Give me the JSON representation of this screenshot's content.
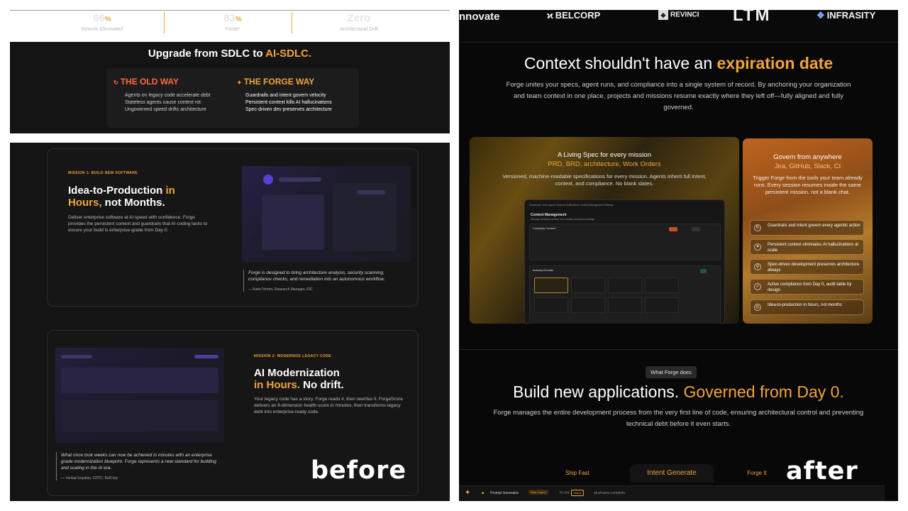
{
  "before": {
    "stats": [
      {
        "value": "66",
        "unit": "%",
        "label": "Rework Eliminated"
      },
      {
        "value": "83",
        "unit": "%",
        "label": "Faster"
      },
      {
        "value": "Zero",
        "unit": "",
        "label": "Architectural Drift"
      }
    ],
    "upgrade": {
      "title_pre": "Upgrade from SDLC to ",
      "title_hl": "AI-SDLC.",
      "old": {
        "title": "THE OLD WAY",
        "items": [
          "Agents on legacy code accelerate debt",
          "Stateless agents cause context rot",
          "Ungoverned speed drifts architecture"
        ]
      },
      "forge": {
        "title": "THE FORGE WAY",
        "items": [
          "Guardrails and intent govern velocity",
          "Persistent context kills AI hallucinations",
          "Spec-driven dev preserves architecture"
        ]
      }
    },
    "mission1": {
      "tag": "MISSION 1: BUILD NEW SOFTWARE",
      "title_a": "Idea-to-Production ",
      "title_hl": "in Hours,",
      "title_b": " not Months.",
      "desc": "Deliver enterprise software at AI speed with confidence. Forge provides the persistent context and guardrails that AI coding lacks to ensure your build is enterprise-grade from Day 0.",
      "quote": "Forge is designed to bring architecture analysis, security scanning, compliance checks, and remediation into an autonomous workflow.",
      "author": "— Katie Norton, Research Manager, IDC"
    },
    "mission2": {
      "tag": "MISSION 2: MODERNIZE LEGACY CODE",
      "title_a": "AI Modernization",
      "title_hl": "in Hours.",
      "title_b": " No drift.",
      "desc": "Your legacy code has a story. Forge reads it, then rewrites it. ForgeScore delivers an 8-dimension health score in minutes, then transforms legacy debt into enterprise-ready code.",
      "quote": "What once took weeks can now be achieved in minutes with an enterprise grade modernization blueprint. Forge represents a new standard for building and scaling in the AI era.",
      "author": "— Venkat Gopalan, CDTO, BelCorp"
    },
    "label": "before"
  },
  "after": {
    "logos": [
      "nnovate",
      "BELCORP",
      "REVINCI",
      "LTM",
      "INFRASITY"
    ],
    "context": {
      "title_pre": "Context shouldn't have an ",
      "title_hl": "expiration date",
      "subtitle": "Forge unites your specs, agent runs, and compliance into a single system of record. By anchoring your organization and team context in one place, projects and missions resume exactly where they left off—fully aligned and fully governed."
    },
    "living_spec": {
      "title": "A Living Spec for every mission",
      "title_hl": "PRD, BRD, architecture, Work Orders",
      "desc": "Versioned, machine-readable specifications for every mission. Agents inherit full intent, context, and compliance. No blank slates.",
      "mock": {
        "nav": "Dashboard   Jobs   Agents   Reports   Notifications   Context Management   Settings",
        "heading": "Context Management",
        "sub": "Manage company context and industry domain knowledge",
        "section1": "Company Context",
        "section2": "Industry Domain"
      }
    },
    "govern": {
      "title": "Govern from anywhere",
      "title_hl": "Jira, GitHub, Slack, CI",
      "desc": "Trigger Forge from the tools your team already runs. Every session resumes inside the same persistent mission, not a blank chat.",
      "features": [
        "Guardrails and intent govern every agentic action",
        "Persistent context eliminates AI hallucinations at scale",
        "Spec-driven development preserves architecture always",
        "Active compliance from Day 0, audit table by design.",
        "Idea-to-production in hours, not months"
      ]
    },
    "what": {
      "pill": "What Forge does",
      "title_pre": "Build new applications. ",
      "title_hl": "Governed from Day 0.",
      "subtitle": "Forge manages the entire development process from the very first line of code, ensuring architectural control and preventing technical debt before it even starts."
    },
    "tabs": [
      "Ship Fast",
      "Intent Generate",
      "Forge It"
    ],
    "active_tab": 1,
    "prompt_bar": {
      "label": "Prompt Generator",
      "badge": "New Project",
      "step": "Pr 0/4",
      "badge2": "Intent",
      "status": "all phases complete"
    },
    "label": "after"
  },
  "colors": {
    "accent": "#f0a43a",
    "old_red": "#ff6a3d"
  }
}
